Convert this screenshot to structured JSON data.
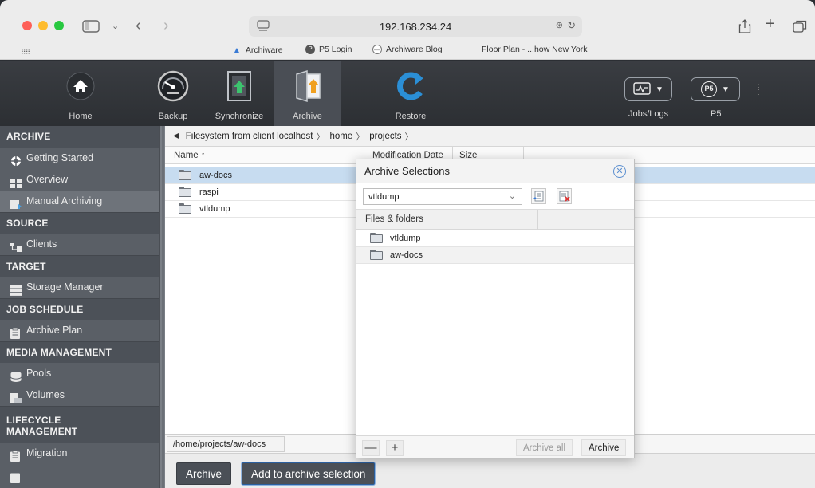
{
  "browser": {
    "address": "192.168.234.24",
    "bookmarks": [
      {
        "label": "Archiware",
        "icon": "triangle-icon"
      },
      {
        "label": "P5 Login",
        "icon": "p5-icon"
      },
      {
        "label": "Archiware Blog",
        "icon": "globe-icon"
      },
      {
        "label": "Floor Plan - ...how New York",
        "icon": ""
      }
    ]
  },
  "toolbar": {
    "home": "Home",
    "backup": "Backup",
    "synchronize": "Synchronize",
    "archive": "Archive",
    "restore": "Restore",
    "jobs": "Jobs/Logs",
    "p5": "P5"
  },
  "sidebar": {
    "archive": "ARCHIVE",
    "getting_started": "Getting Started",
    "overview": "Overview",
    "manual_archiving": "Manual Archiving",
    "source": "SOURCE",
    "clients": "Clients",
    "target": "TARGET",
    "storage_manager": "Storage Manager",
    "job_schedule": "JOB SCHEDULE",
    "archive_plan": "Archive Plan",
    "media_management": "MEDIA MANAGEMENT",
    "pools": "Pools",
    "volumes": "Volumes",
    "lifecycle_1": "LIFECYCLE",
    "lifecycle_2": "MANAGEMENT",
    "migration": "Migration"
  },
  "breadcrumb": {
    "root": "Filesystem from client localhost",
    "home": "home",
    "projects": "projects"
  },
  "table": {
    "col_name": "Name ↑",
    "col_modified": "Modification Date",
    "col_size": "Size",
    "rows": [
      "aw-docs",
      "raspi",
      "vtldump"
    ]
  },
  "path": "/home/projects/aw-docs",
  "buttons": {
    "archive": "Archive",
    "add_to_selection": "Add to archive selection"
  },
  "popup": {
    "title": "Archive Selections",
    "selection": "vtldump",
    "col_files": "Files & folders",
    "rows": [
      "vtldump",
      "aw-docs"
    ],
    "archive_all": "Archive all",
    "archive": "Archive",
    "minus": "—",
    "plus": "+"
  },
  "colors": {
    "selection": "#c7dcf0",
    "accent": "#3a7bd5",
    "dark_button": "#4b5057"
  }
}
